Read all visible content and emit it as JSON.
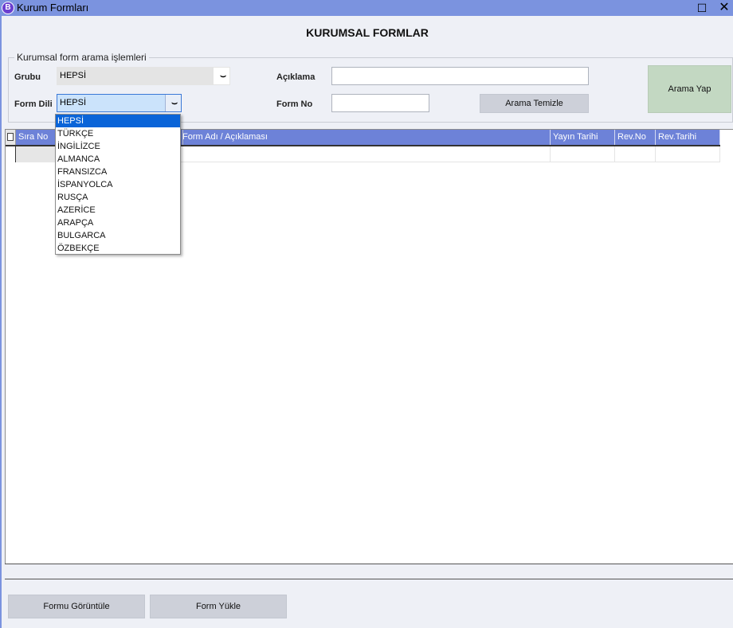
{
  "window": {
    "title": "Kurum Formları",
    "icon_letter": "B",
    "maximize_glyph": "☐",
    "close_glyph": "✕"
  },
  "page": {
    "title": "KURUMSAL FORMLAR"
  },
  "search": {
    "legend": "Kurumsal form arama işlemleri",
    "grubu_label": "Grubu",
    "grubu_value": "HEPSİ",
    "form_dili_label": "Form Dili",
    "form_dili_value": "HEPSİ",
    "aciklama_label": "Açıklama",
    "aciklama_value": "",
    "form_no_label": "Form No",
    "form_no_value": "",
    "clear_button": "Arama Temizle",
    "search_button": "Arama Yap",
    "arrow_glyph": "⌣"
  },
  "grid": {
    "columns": [
      "Sıra No",
      "Form Adı / Açıklaması",
      "Yayın Tarihi",
      "Rev.No",
      "Rev.Tarihi"
    ]
  },
  "dropdown": {
    "selected_index": 0,
    "options": [
      "HEPSİ",
      "TÜRKÇE",
      "İNGİLİZCE",
      "ALMANCA",
      "FRANSIZCA",
      "İSPANYOLCA",
      "RUSÇA",
      "AZERİCE",
      "ARAPÇA",
      "BULGARCA",
      "ÖZBEKÇE"
    ]
  },
  "footer": {
    "view_button": "Formu Görüntüle",
    "upload_button": "Form Yükle"
  }
}
